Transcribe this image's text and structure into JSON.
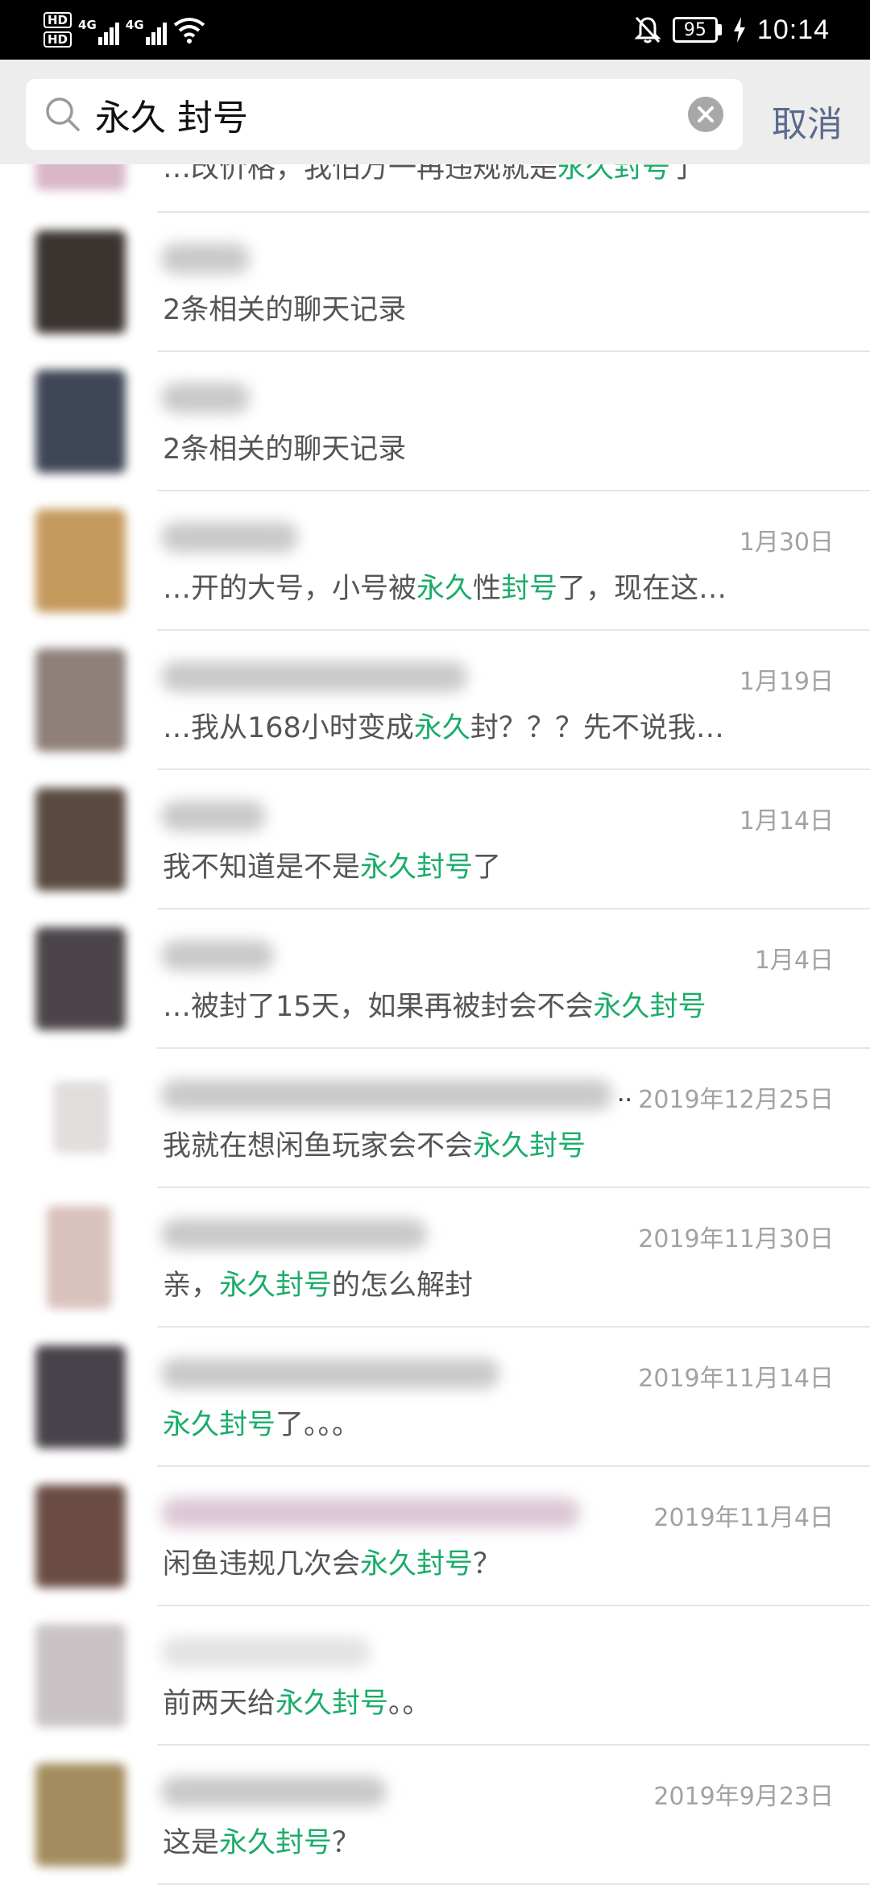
{
  "status_bar": {
    "hd_badges": [
      "HD",
      "HD"
    ],
    "network_1": "4G",
    "network_2": "4G",
    "battery_level": "95",
    "time": "10:14"
  },
  "search": {
    "query": "永久 封号",
    "cancel_label": "取消"
  },
  "results": [
    {
      "date": "",
      "snippet": [
        [
          "…改价格，我怕万一再违规就是",
          false
        ],
        [
          "永久封号",
          true
        ],
        [
          "了",
          false
        ]
      ]
    },
    {
      "date": "",
      "snippet": [
        [
          "2条相关的聊天记录",
          false
        ]
      ]
    },
    {
      "date": "",
      "snippet": [
        [
          "2条相关的聊天记录",
          false
        ]
      ]
    },
    {
      "date": "1月30日",
      "snippet": [
        [
          "…开的大号，小号被",
          false
        ],
        [
          "永久",
          true
        ],
        [
          "性",
          false
        ],
        [
          "封号",
          true
        ],
        [
          "了，现在这…",
          false
        ]
      ]
    },
    {
      "date": "1月19日",
      "snippet": [
        [
          "…我从168小时变成",
          false
        ],
        [
          "永久",
          true
        ],
        [
          "封？？？先不说我…",
          false
        ]
      ]
    },
    {
      "date": "1月14日",
      "snippet": [
        [
          "我不知道是不是",
          false
        ],
        [
          "永久封号",
          true
        ],
        [
          "了",
          false
        ]
      ]
    },
    {
      "date": "1月4日",
      "snippet": [
        [
          "…被封了15天，如果再被封会不会",
          false
        ],
        [
          "永久封号",
          true
        ]
      ]
    },
    {
      "date": "2019年12月25日",
      "snippet": [
        [
          "我就在想闲鱼玩家会不会",
          false
        ],
        [
          "永久封号",
          true
        ]
      ]
    },
    {
      "date": "2019年11月30日",
      "snippet": [
        [
          "亲，",
          false
        ],
        [
          "永久封号",
          true
        ],
        [
          "的怎么解封",
          false
        ]
      ]
    },
    {
      "date": "2019年11月14日",
      "snippet": [
        [
          "永久封号",
          true
        ],
        [
          "了。。。",
          false
        ]
      ]
    },
    {
      "date": "2019年11月4日",
      "snippet": [
        [
          "闲鱼违规几次会",
          false
        ],
        [
          "永久封号",
          true
        ],
        [
          "？",
          false
        ]
      ]
    },
    {
      "date": "",
      "snippet": [
        [
          "前两天给",
          false
        ],
        [
          "永久封号",
          true
        ],
        [
          "。。",
          false
        ]
      ]
    },
    {
      "date": "2019年9月23日",
      "snippet": [
        [
          "这是",
          false
        ],
        [
          "永久封号",
          true
        ],
        [
          "？",
          false
        ]
      ]
    }
  ],
  "colors": {
    "highlight": "#1aad6a",
    "cancel": "#5b6b8c",
    "header_bg": "#ededed",
    "date": "#a2a2a2"
  },
  "icons": [
    "hd-icon",
    "signal-icon",
    "wifi-icon",
    "mute-bell-icon",
    "battery-icon",
    "charging-icon",
    "search-icon",
    "clear-icon"
  ]
}
